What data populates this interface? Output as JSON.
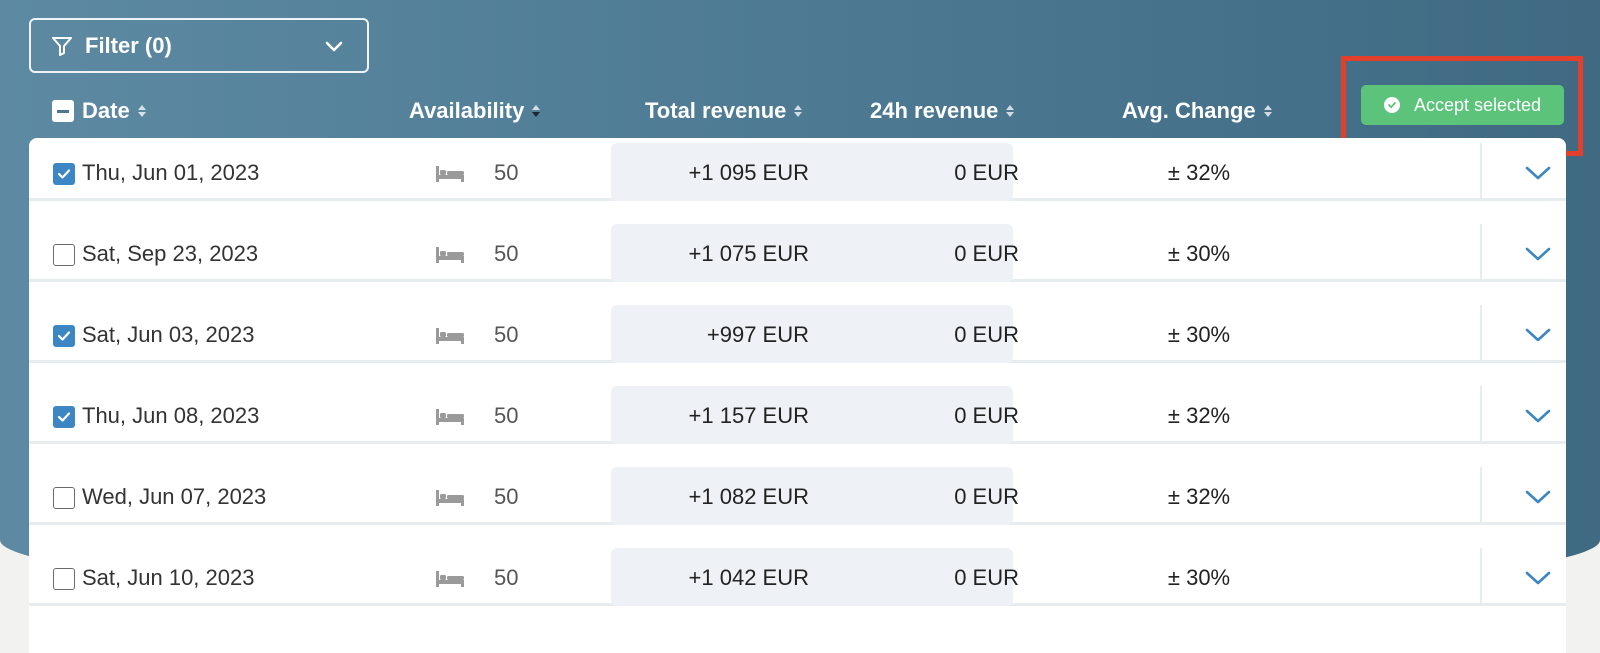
{
  "filter": {
    "label": "Filter (0)",
    "icon": "funnel-icon"
  },
  "columns": {
    "date": "Date",
    "availability": "Availability",
    "total_revenue": "Total revenue",
    "revenue_24h": "24h revenue",
    "avg_change": "Avg. Change"
  },
  "actions": {
    "accept_selected": "Accept selected"
  },
  "colors": {
    "accent_green": "#5cc47a",
    "highlight_red": "#e2402b",
    "checkbox_blue": "#3d86c4"
  },
  "rows": [
    {
      "checked": true,
      "date": "Thu, Jun 01, 2023",
      "availability": "50",
      "total_revenue": "+1 095 EUR",
      "revenue_24h": "0 EUR",
      "avg_change": "± 32%"
    },
    {
      "checked": false,
      "date": "Sat, Sep 23, 2023",
      "availability": "50",
      "total_revenue": "+1 075 EUR",
      "revenue_24h": "0 EUR",
      "avg_change": "± 30%"
    },
    {
      "checked": true,
      "date": "Sat, Jun 03, 2023",
      "availability": "50",
      "total_revenue": "+997 EUR",
      "revenue_24h": "0 EUR",
      "avg_change": "± 30%"
    },
    {
      "checked": true,
      "date": "Thu, Jun 08, 2023",
      "availability": "50",
      "total_revenue": "+1 157 EUR",
      "revenue_24h": "0 EUR",
      "avg_change": "± 32%"
    },
    {
      "checked": false,
      "date": "Wed, Jun 07, 2023",
      "availability": "50",
      "total_revenue": "+1 082 EUR",
      "revenue_24h": "0 EUR",
      "avg_change": "± 32%"
    },
    {
      "checked": false,
      "date": "Sat, Jun 10, 2023",
      "availability": "50",
      "total_revenue": "+1 042 EUR",
      "revenue_24h": "0 EUR",
      "avg_change": "± 30%"
    }
  ]
}
